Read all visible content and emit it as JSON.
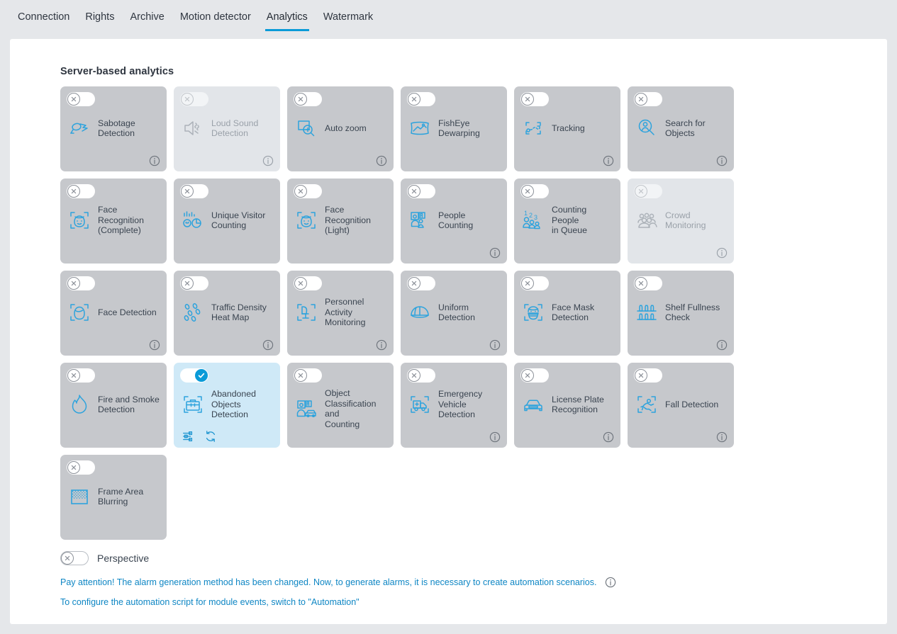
{
  "tabs": [
    {
      "label": "Connection",
      "active": false
    },
    {
      "label": "Rights",
      "active": false
    },
    {
      "label": "Archive",
      "active": false
    },
    {
      "label": "Motion detector",
      "active": false
    },
    {
      "label": "Analytics",
      "active": true
    },
    {
      "label": "Watermark",
      "active": false
    }
  ],
  "section": {
    "title": "Server-based analytics"
  },
  "colors": {
    "accent": "#0a9bd8",
    "page_bg": "#e5e7ea",
    "panel_bg": "#ffffff",
    "card_bg": "#c6c8cc",
    "card_bg_disabled": "#e2e5e9",
    "card_bg_on": "#cfe9f7",
    "icon_blue": "#2da3dd",
    "label": "#3a4450",
    "link": "#0e86c4"
  },
  "cards": [
    {
      "label": "Sabotage\nDetection",
      "icon": "sabotage-icon",
      "state": "off",
      "info": true,
      "actions": []
    },
    {
      "label": "Loud Sound\nDetection",
      "icon": "loud-sound-icon",
      "state": "disabled",
      "info": true,
      "actions": []
    },
    {
      "label": "Auto zoom",
      "icon": "auto-zoom-icon",
      "state": "off",
      "info": true,
      "actions": []
    },
    {
      "label": "FishEye\nDewarping",
      "icon": "fisheye-dewarping-icon",
      "state": "off",
      "info": false,
      "actions": []
    },
    {
      "label": "Tracking",
      "icon": "tracking-icon",
      "state": "off",
      "info": true,
      "actions": []
    },
    {
      "label": "Search for\nObjects",
      "icon": "search-objects-icon",
      "state": "off",
      "info": true,
      "actions": []
    },
    {
      "label": "Face Recognition\n(Complete)",
      "icon": "face-recognition-icon",
      "state": "off",
      "info": false,
      "actions": []
    },
    {
      "label": "Unique Visitor\nCounting",
      "icon": "unique-visitor-icon",
      "state": "off",
      "info": false,
      "actions": []
    },
    {
      "label": "Face Recognition\n(Light)",
      "icon": "face-recognition-icon",
      "state": "off",
      "info": false,
      "actions": []
    },
    {
      "label": "People Counting",
      "icon": "people-counting-icon",
      "state": "off",
      "info": true,
      "actions": []
    },
    {
      "label": "Counting People\nin Queue",
      "icon": "queue-counting-icon",
      "state": "off",
      "info": false,
      "actions": []
    },
    {
      "label": "Crowd\nMonitoring",
      "icon": "crowd-monitoring-icon",
      "state": "disabled",
      "info": true,
      "actions": []
    },
    {
      "label": "Face Detection",
      "icon": "face-detection-icon",
      "state": "off",
      "info": true,
      "actions": []
    },
    {
      "label": "Traffic Density\nHeat Map",
      "icon": "heat-map-icon",
      "state": "off",
      "info": true,
      "actions": []
    },
    {
      "label": "Personnel Activity\nMonitoring",
      "icon": "personnel-activity-icon",
      "state": "off",
      "info": true,
      "actions": []
    },
    {
      "label": "Uniform\nDetection",
      "icon": "uniform-detection-icon",
      "state": "off",
      "info": true,
      "actions": []
    },
    {
      "label": "Face Mask\nDetection",
      "icon": "face-mask-icon",
      "state": "off",
      "info": false,
      "actions": []
    },
    {
      "label": "Shelf Fullness\nCheck",
      "icon": "shelf-fullness-icon",
      "state": "off",
      "info": true,
      "actions": []
    },
    {
      "label": "Fire and Smoke\nDetection",
      "icon": "fire-smoke-icon",
      "state": "off",
      "info": false,
      "actions": []
    },
    {
      "label": "Abandoned\nObjects\nDetection",
      "icon": "abandoned-objects-icon",
      "state": "on",
      "info": false,
      "actions": [
        "settings-icon",
        "refresh-icon"
      ]
    },
    {
      "label": "Object\nClassification and\nCounting",
      "icon": "object-classification-icon",
      "state": "off",
      "info": false,
      "actions": []
    },
    {
      "label": "Emergency\nVehicle Detection",
      "icon": "emergency-vehicle-icon",
      "state": "off",
      "info": true,
      "actions": []
    },
    {
      "label": "License Plate\nRecognition",
      "icon": "license-plate-icon",
      "state": "off",
      "info": true,
      "actions": []
    },
    {
      "label": "Fall Detection",
      "icon": "fall-detection-icon",
      "state": "off",
      "info": true,
      "actions": []
    },
    {
      "label": "Frame Area\nBlurring",
      "icon": "frame-blur-icon",
      "state": "off",
      "info": false,
      "actions": []
    }
  ],
  "perspective": {
    "label": "Perspective",
    "state": "off"
  },
  "notes": [
    {
      "text": "Pay attention! The alarm generation method has been changed. Now, to generate alarms, it is necessary to create automation scenarios.",
      "info": true
    },
    {
      "text": "To configure the automation script for module events, switch to \"Automation\"",
      "info": false
    }
  ]
}
